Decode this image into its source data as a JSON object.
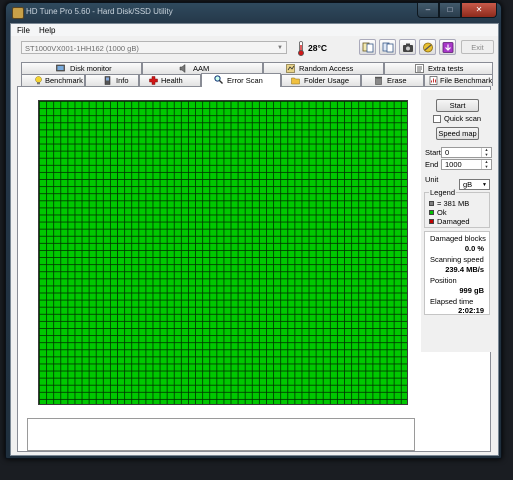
{
  "window": {
    "title": "HD Tune Pro 5.60 - Hard Disk/SSD Utility",
    "caption_buttons": {
      "minimize": "–",
      "maximize": "□",
      "close": "✕"
    }
  },
  "menu": {
    "file": "File",
    "help": "Help"
  },
  "toolbar": {
    "drive": "ST1000VX001-1HH162 (1000 gB)",
    "temperature": "28°C",
    "exit": "Exit",
    "icons": [
      "copy-text-icon",
      "copy-info-icon",
      "screenshot-camera-icon",
      "options-icon",
      "save-icon"
    ]
  },
  "tabs_top": [
    {
      "label": "Disk monitor",
      "icon": "disk-monitor-icon"
    },
    {
      "label": "AAM",
      "icon": "speaker-icon"
    },
    {
      "label": "Random Access",
      "icon": "random-access-icon"
    },
    {
      "label": "Extra tests",
      "icon": "extra-tests-icon"
    }
  ],
  "tabs_bottom": [
    {
      "label": "Benchmark",
      "icon": "lightbulb-icon"
    },
    {
      "label": "Info",
      "icon": "info-icon"
    },
    {
      "label": "Health",
      "icon": "health-cross-icon"
    },
    {
      "label": "Error Scan",
      "icon": "magnifier-icon",
      "active": true
    },
    {
      "label": "Folder Usage",
      "icon": "folder-icon"
    },
    {
      "label": "Erase",
      "icon": "trash-icon"
    },
    {
      "label": "File Benchmark",
      "icon": "file-benchmark-icon"
    }
  ],
  "scan": {
    "start_button": "Start",
    "quick_scan": "Quick scan",
    "quick_scan_checked": false,
    "speed_map_button": "Speed map",
    "start_label": "Start",
    "start_value": "0",
    "end_label": "End",
    "end_value": "1000",
    "unit_label": "Unit",
    "unit_value": "gB",
    "legend": {
      "title": "Legend",
      "block_size": "= 381 MB",
      "ok": "Ok",
      "damaged": "Damaged",
      "colors": {
        "block": "#808080",
        "ok": "#00c000",
        "damaged": "#c00000"
      }
    },
    "stats": {
      "damaged_blocks_label": "Damaged blocks",
      "damaged_blocks_value": "0.0 %",
      "scanning_speed_label": "Scanning speed",
      "scanning_speed_value": "239.4 MB/s",
      "position_label": "Position",
      "position_value": "999 gB",
      "elapsed_label": "Elapsed time",
      "elapsed_value": "2:02:19"
    },
    "grid_color": "#00c800"
  }
}
